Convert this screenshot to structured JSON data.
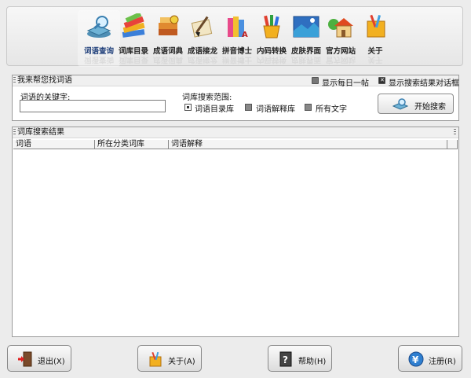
{
  "toolbar": {
    "items": [
      {
        "label": "词语查询",
        "icon": "search-book-icon",
        "active": true
      },
      {
        "label": "词库目录",
        "icon": "books-stack-icon"
      },
      {
        "label": "成语词典",
        "icon": "dictionary-icon"
      },
      {
        "label": "成语接龙",
        "icon": "scroll-brush-icon"
      },
      {
        "label": "拼音博士",
        "icon": "pinyin-books-icon"
      },
      {
        "label": "内码转换",
        "icon": "pencil-cup-icon"
      },
      {
        "label": "皮肤界面",
        "icon": "landscape-icon"
      },
      {
        "label": "官方网站",
        "icon": "house-icon"
      },
      {
        "label": "关于",
        "icon": "notebook-icon"
      }
    ]
  },
  "search_panel": {
    "title": "我来帮您找词语",
    "show_daily_tip": "显示每日一帖",
    "show_results_dialog": "显示搜索结果对话框",
    "keyword_label": "词语的关键字:",
    "keyword_value": "",
    "scope_label": "词库搜索范围:",
    "scope_options": [
      "词语目录库",
      "词语解释库",
      "所有文字"
    ],
    "search_button": "开始搜索"
  },
  "results_panel": {
    "title": "词库搜索结果",
    "columns": [
      "词语",
      "所在分类词库",
      "词语解释"
    ]
  },
  "bottom_buttons": {
    "exit": "退出(X)",
    "about": "关于(A)",
    "help": "帮助(H)",
    "register": "注册(R)"
  }
}
